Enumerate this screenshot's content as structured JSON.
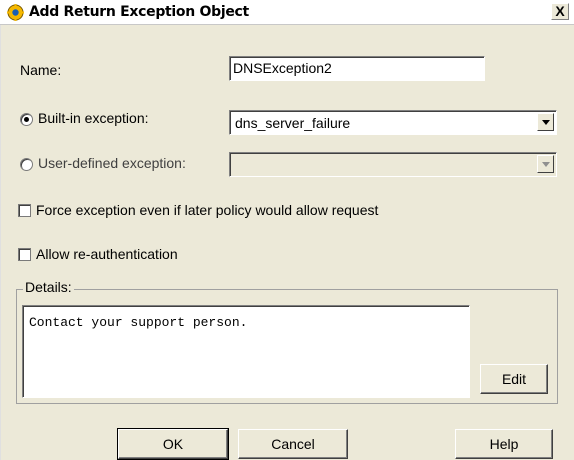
{
  "window": {
    "title": "Add Return Exception Object",
    "close_label": "X"
  },
  "form": {
    "name_label": "Name:",
    "name_value": "DNSException2",
    "builtin_label": "Built-in exception:",
    "builtin_value": "dns_server_failure",
    "builtin_selected": true,
    "userdefined_label": "User-defined exception:",
    "userdefined_value": "",
    "force_label": "Force exception even if later policy would allow request",
    "force_checked": false,
    "reauth_label": "Allow re-authentication",
    "reauth_checked": false
  },
  "details": {
    "group_label": "Details:",
    "text": "Contact your support person.",
    "edit_label": "Edit"
  },
  "buttons": {
    "ok": "OK",
    "cancel": "Cancel",
    "help": "Help"
  },
  "colors": {
    "dialog_bg": "#ece9d8",
    "icon_fill": "#f5b800",
    "icon_center": "#1a5fb4"
  },
  "icons": {
    "app": "gear-warning-icon",
    "close": "close-icon",
    "dropdown": "chevron-down-icon"
  }
}
